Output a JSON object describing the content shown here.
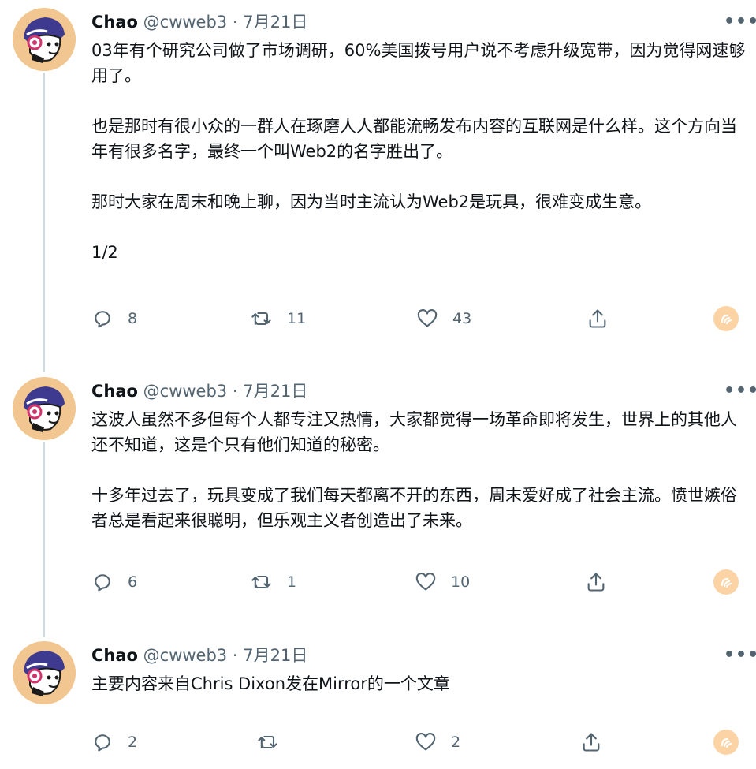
{
  "tweets": [
    {
      "name": "Chao",
      "handle": "@cwweb3",
      "dot": "·",
      "date": "7月21日",
      "paragraphs": [
        "03年有个研究公司做了市场调研，60%美国拨号用户说不考虑升级宽带，因为觉得网速够用了。",
        "也是那时有很小众的一群人在琢磨人人都能流畅发布内容的互联网是什么样。这个方向当年有很多名字，最终一个叫Web2的名字胜出了。",
        "那时大家在周末和晚上聊，因为当时主流认为Web2是玩具，很难变成生意。",
        "1/2"
      ],
      "replies": "8",
      "retweets": "11",
      "likes": "43"
    },
    {
      "name": "Chao",
      "handle": "@cwweb3",
      "dot": "·",
      "date": "7月21日",
      "paragraphs": [
        "这波人虽然不多但每个人都专注又热情，大家都觉得一场革命即将发生，世界上的其他人还不知道，这是个只有他们知道的秘密。",
        "十多年过去了，玩具变成了我们每天都离不开的东西，周末爱好成了社会主流。愤世嫉俗者总是看起来很聪明，但乐观主义者创造出了未来。"
      ],
      "replies": "6",
      "retweets": "1",
      "likes": "10"
    },
    {
      "name": "Chao",
      "handle": "@cwweb3",
      "dot": "·",
      "date": "7月21日",
      "paragraphs": [
        "主要内容来自Chris Dixon发在Mirror的一个文章"
      ],
      "replies": "2",
      "retweets": "",
      "likes": "2"
    }
  ],
  "icons": {
    "more": "more-horizontal-icon",
    "reply": "reply-icon",
    "retweet": "retweet-icon",
    "like": "heart-icon",
    "share": "share-icon",
    "extension": "sidekick-icon"
  },
  "colors": {
    "text": "#0f1419",
    "secondary": "#536471",
    "thread_line": "#cfd9de",
    "avatar_bg": "#f2c690",
    "extension_bg": "#fbd3a5"
  }
}
